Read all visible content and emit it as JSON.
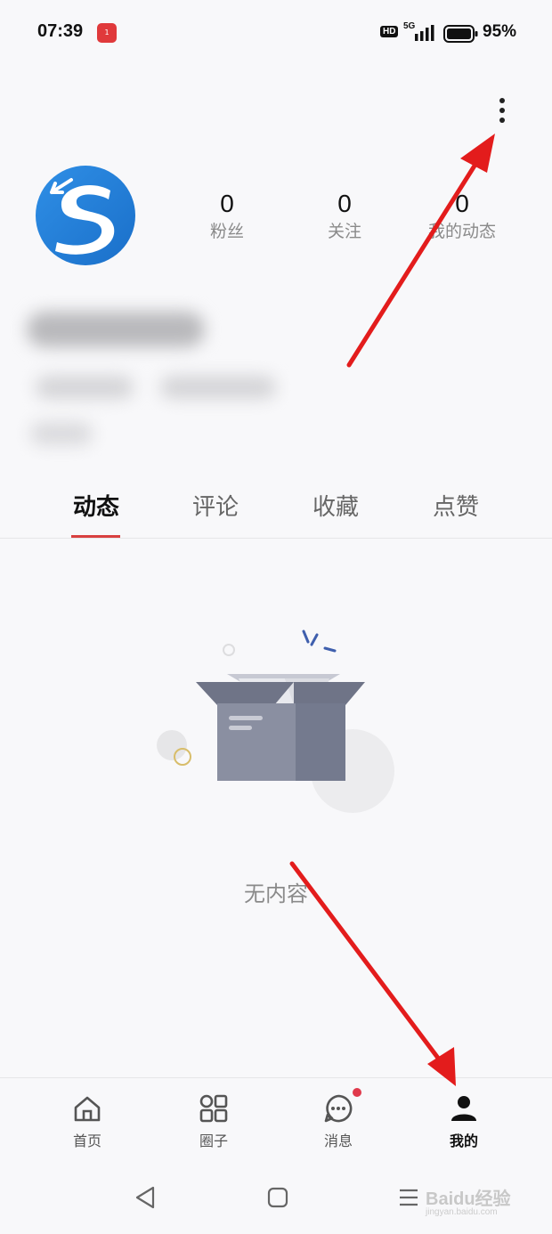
{
  "status_bar": {
    "time": "07:39",
    "notification_count": "1",
    "hd_label": "HD",
    "network": "5G",
    "battery": "95%"
  },
  "header": {
    "more_icon": "more-vertical-icon"
  },
  "profile": {
    "stats": [
      {
        "value": "0",
        "label": "粉丝"
      },
      {
        "value": "0",
        "label": "关注"
      },
      {
        "value": "0",
        "label": "我的动态"
      }
    ]
  },
  "tabs": [
    {
      "label": "动态",
      "active": true
    },
    {
      "label": "评论",
      "active": false
    },
    {
      "label": "收藏",
      "active": false
    },
    {
      "label": "点赞",
      "active": false
    }
  ],
  "empty_state": {
    "icon": "empty-box-icon",
    "text": "无内容"
  },
  "bottom_nav": [
    {
      "label": "首页",
      "icon": "home-icon",
      "active": false
    },
    {
      "label": "圈子",
      "icon": "grid-icon",
      "active": false
    },
    {
      "label": "消息",
      "icon": "chat-icon",
      "active": false,
      "has_dot": true
    },
    {
      "label": "我的",
      "icon": "user-icon",
      "active": true
    }
  ],
  "watermark": {
    "brand": "Baidu经验",
    "url": "jingyan.baidu.com"
  },
  "colors": {
    "accent": "#d94040",
    "annotation_arrow": "#e31c1c",
    "background": "#f8f8fa"
  }
}
